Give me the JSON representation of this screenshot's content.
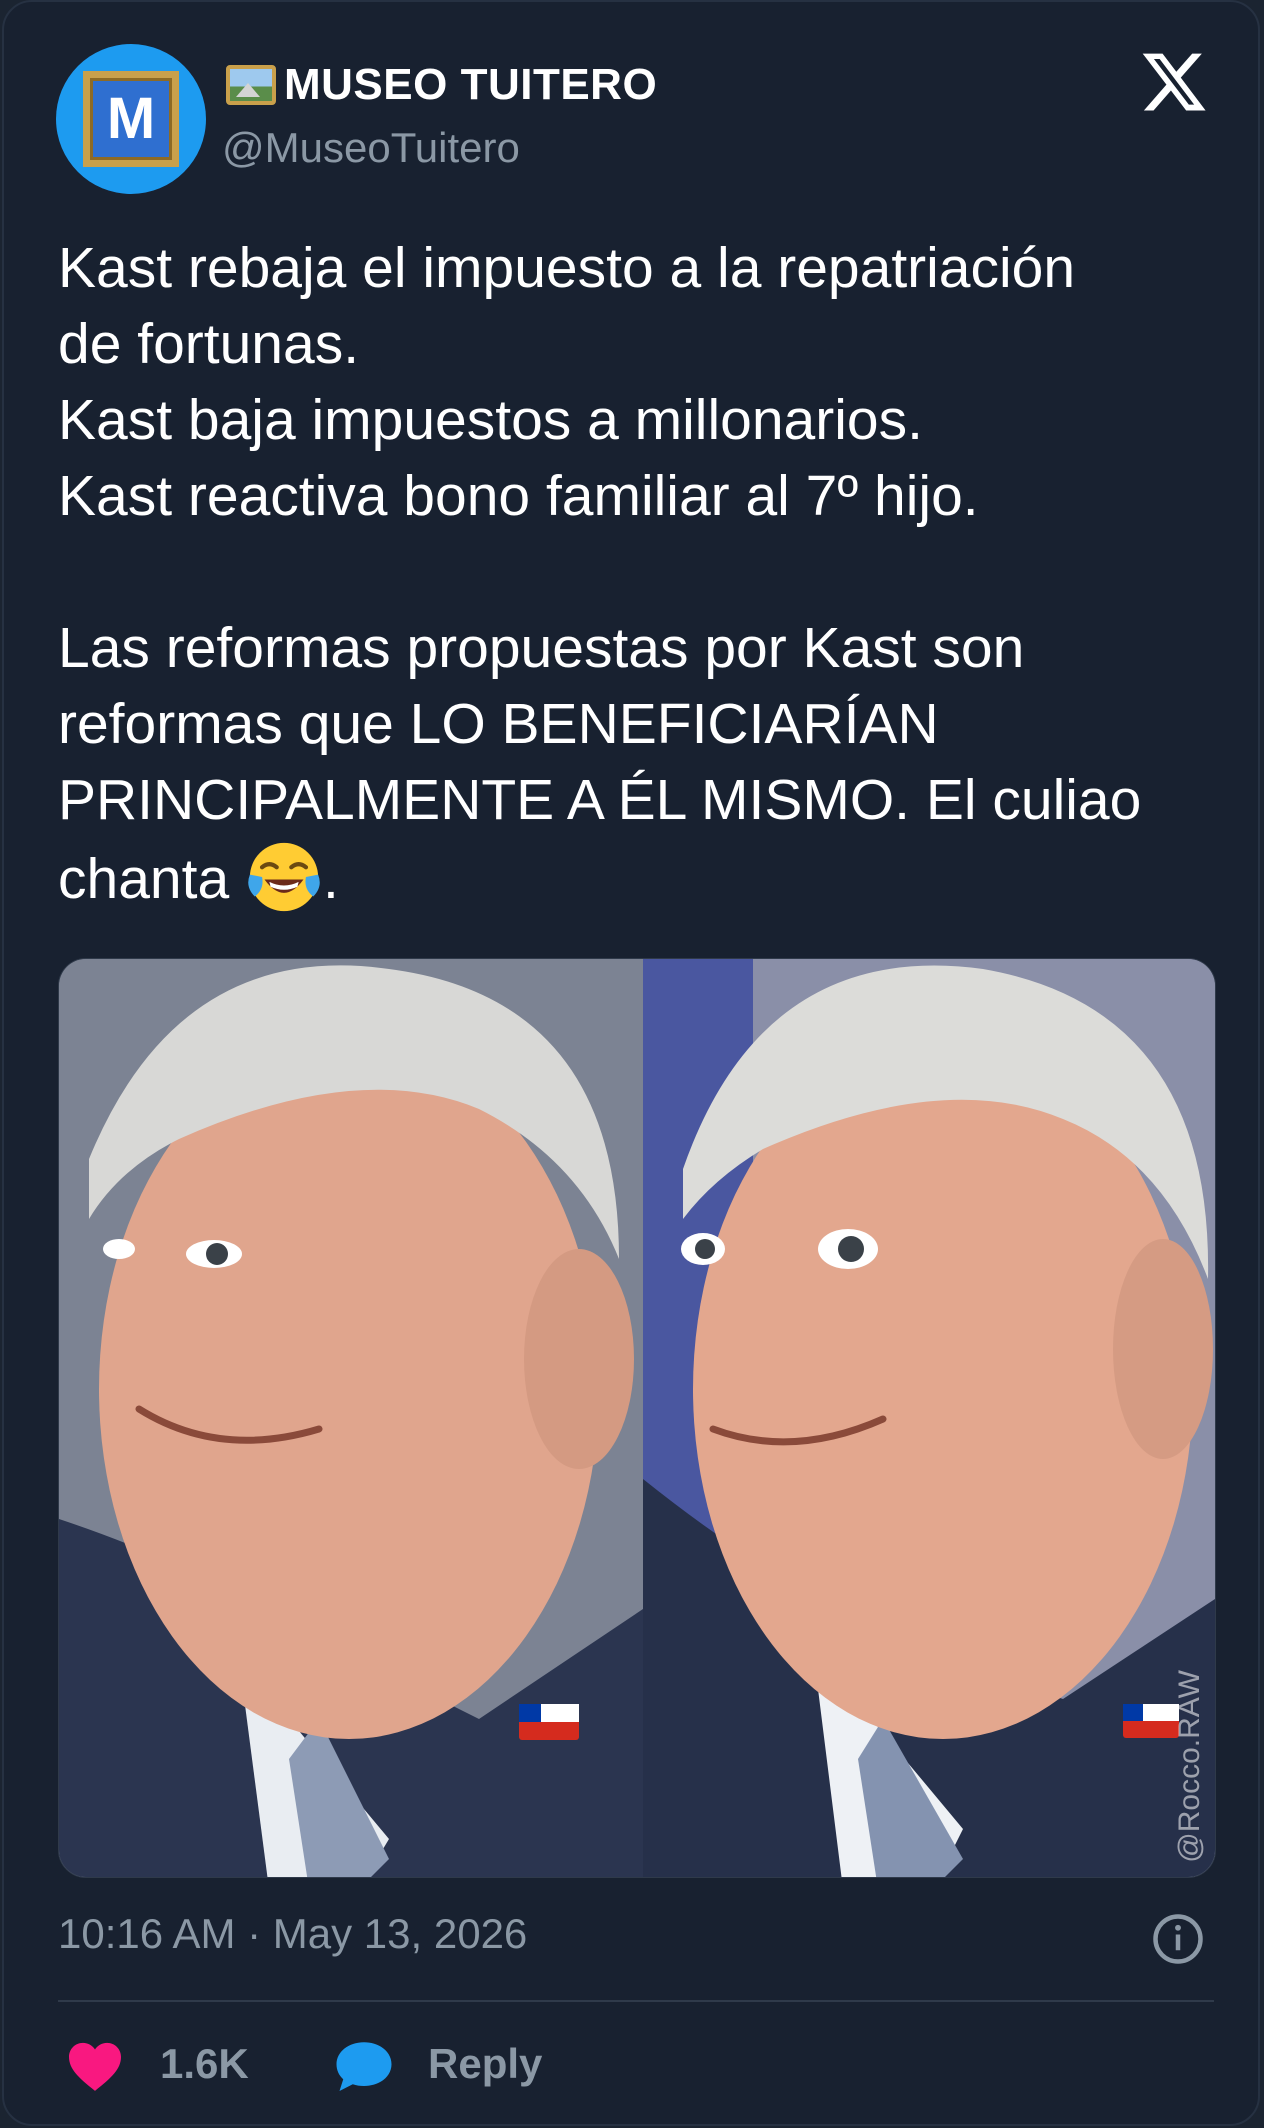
{
  "colors": {
    "background": "#182130",
    "accent": "#1d9bf0",
    "like": "#f91880",
    "muted": "#8b98a5"
  },
  "header": {
    "avatar_letter": "M",
    "display_name": "MUSEO TUITERO",
    "name_emoji": "framed-picture-icon",
    "handle": "@MuseoTuitero",
    "platform_icon": "x-logo-icon"
  },
  "tweet": {
    "line1": "Kast rebaja el impuesto a la repatriación\nde fortunas.\nKast baja impuestos a millonarios.\nKast reactiva bono familiar al 7º hijo.",
    "line2_main": "Las reformas propuestas por Kast son\nreformas que LO BENEFICIARÍAN\nPRINCIPALMENTE A ÉL MISMO. El culiao\nchanta ",
    "line2_end": ".",
    "emoji": "face-with-tears-of-joy-icon"
  },
  "media": {
    "watermark": "@Rocco.RAW"
  },
  "footer": {
    "timestamp": "10:16 AM · May 13, 2026",
    "likes": "1.6K",
    "reply_label": "Reply"
  }
}
